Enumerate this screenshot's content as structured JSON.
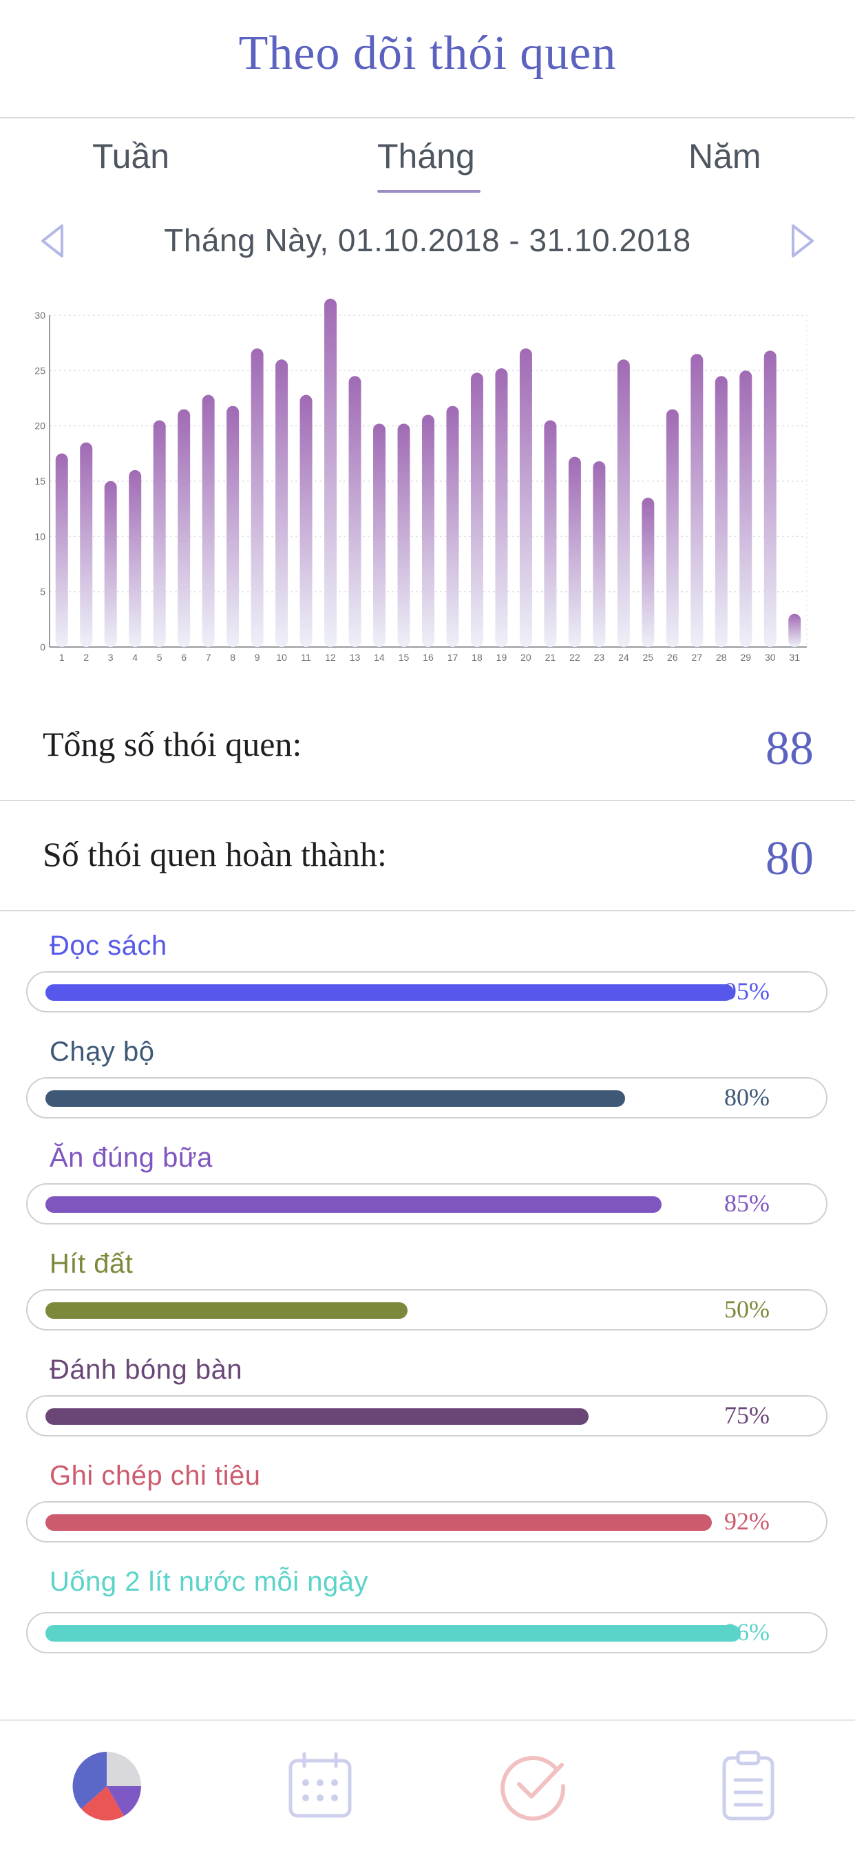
{
  "header": {
    "title": "Theo dõi thói quen"
  },
  "tabs": [
    {
      "label": "Tuần"
    },
    {
      "label": "Tháng"
    },
    {
      "label": "Năm"
    }
  ],
  "date_range": "Tháng Này, 01.10.2018 - 31.10.2018",
  "chart_data": {
    "type": "bar",
    "categories": [
      "1",
      "2",
      "3",
      "4",
      "5",
      "6",
      "7",
      "8",
      "9",
      "10",
      "11",
      "12",
      "13",
      "14",
      "15",
      "16",
      "17",
      "18",
      "19",
      "20",
      "21",
      "22",
      "23",
      "24",
      "25",
      "26",
      "27",
      "28",
      "29",
      "30",
      "31"
    ],
    "values": [
      17.5,
      18.5,
      15,
      16,
      20.5,
      21.5,
      22.8,
      21.8,
      27,
      26,
      22.8,
      31.5,
      24.5,
      20.2,
      20.2,
      21,
      21.8,
      24.8,
      25.2,
      27,
      20.5,
      17.2,
      16.8,
      26,
      13.5,
      21.5,
      26.5,
      24.5,
      25,
      26.8,
      3
    ],
    "yticks": [
      0,
      5,
      10,
      15,
      20,
      25,
      30
    ],
    "ylim": [
      0,
      30
    ],
    "grid": true
  },
  "stats": {
    "total_label": "Tổng số thói quen:",
    "total_value": "88",
    "completed_label": "Số thói quen hoàn thành:",
    "completed_value": "80"
  },
  "habits": [
    {
      "name": "Đọc sách",
      "percent": 95,
      "percent_label": "95%",
      "color": "#5558ea",
      "text_color": "#5558ea"
    },
    {
      "name": "Chạy bộ",
      "percent": 80,
      "percent_label": "80%",
      "color": "#3e5876",
      "text_color": "#3e5876"
    },
    {
      "name": "Ăn đúng bữa",
      "percent": 85,
      "percent_label": "85%",
      "color": "#7f56c0",
      "text_color": "#7f56c0"
    },
    {
      "name": "Hít đất",
      "percent": 50,
      "percent_label": "50%",
      "color": "#7c893b",
      "text_color": "#7c893b"
    },
    {
      "name": "Đánh bóng bàn",
      "percent": 75,
      "percent_label": "75%",
      "color": "#6a4677",
      "text_color": "#6a4677"
    },
    {
      "name": "Ghi chép chi tiêu",
      "percent": 92,
      "percent_label": "92%",
      "color": "#cc5b6e",
      "text_color": "#cc5b6e"
    },
    {
      "name": "Uống 2 lít nước mỗi ngày",
      "percent": 96,
      "percent_label": "96%",
      "color": "#5ad3c9",
      "text_color": "#5ad3c9"
    }
  ],
  "nav": [
    {
      "icon": "pie-chart-icon",
      "active": true
    },
    {
      "icon": "calendar-icon",
      "active": false
    },
    {
      "icon": "check-circle-icon",
      "active": false
    },
    {
      "icon": "clipboard-icon",
      "active": false
    }
  ],
  "colors": {
    "accent": "#5b62bf",
    "bar_top": "#a06ab4",
    "bar_bottom": "#eef0f8",
    "nav_inactive": "#cdd0ec",
    "nav_check": "#f2c0c0"
  }
}
